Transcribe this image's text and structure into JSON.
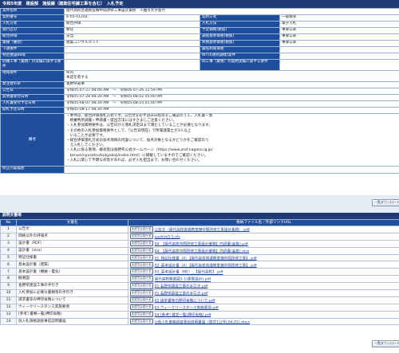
{
  "header": {
    "title": "令和5年度　建設部　施設課（建築住宅課工事を含む）　入札予定"
  },
  "info_rows": [
    {
      "l1": "案件名称",
      "v1": "屋代高校普通教室棟中間改修工事設計業務　千曲市大字屋代",
      "span": true
    },
    {
      "l1": "契約番号",
      "v1": "4-05-01202",
      "l2": "契約方式",
      "v2": "一般競争"
    },
    {
      "l1": "入札方式",
      "v1": "総合評価",
      "l2": "入札方法",
      "v2": "電子入札"
    },
    {
      "l1": "施行区分",
      "v1": "委託",
      "l2": "予定価格(税抜)",
      "v2": "事後公表"
    },
    {
      "l1": "総合評価",
      "v1": "該当",
      "l2": "調査基準価格(税抜)",
      "v2": "事後公表"
    },
    {
      "l1": "業種（種別）",
      "v1": "建築コンサルタント",
      "l2": "失格基準価格(税抜)",
      "v2": "事後公表"
    },
    {
      "l1": "下請要件",
      "v1": "-",
      "l2": "最低制限価格",
      "v2": "-"
    },
    {
      "l1": "特定建設BB等",
      "v1": "-",
      "l2": "WTO(政府調達)案件",
      "v2": "-"
    },
    {
      "l1": "同種工事（業務）の実績に関する要件",
      "v1": "-",
      "l2": "同工事（業務）の契約実績に関する要件",
      "v2": "-"
    },
    {
      "l1": "地域要件",
      "v1": "県内\n本店を有する",
      "span": true
    },
    {
      "l1": "発注者の条",
      "v1": "長野県知事",
      "span": true
    },
    {
      "l1": "公告日",
      "v1": "令和05-07-27 08:00 AM　～　令和06-07-26 11:59 PM",
      "span": true
    },
    {
      "l1": "質問書受付日時",
      "v1": "令和05-07-28 08:30 AM　～　令和05-08-02 05:00 PM",
      "span": true
    },
    {
      "l1": "入札書受付予定日時",
      "v1": "令和05-08-07 08:30 AM　～　令和05-08-10 01:00 PM",
      "span": true
    },
    {
      "l1": "開札予定日時",
      "v1": "令和05-08-17 08:30 AM",
      "span": true
    }
  ],
  "remarks_label": "備考",
  "remarks_lines": [
    "・本件は、総合評価落札方式です。公告文を必ず読み日程等をご確認のうえ、入札書・資",
    "　格審判所調書・申請書・提出方法にはすさまじご注意ください。",
    "・入札参加資格要件は、公告日から落札決定日まで満たしていることが必要となります。",
    "・その他の入札参加資格要件として、「公告日現在」で所属建築士が3人以上",
    "　いることが必要です。",
    "・総合評価落札方式の加点項目の内容について、加点対象となるかどうかをご確認のう",
    "　え入札してください。",
    "・入札に係る重項、様式等は長野県公式ホームページ（https://www.pref.nagano.lg.jp/",
    "　kensei/nyusatsu/kokyokoji/index.html）に掲載していますのでご確認ください。",
    "・入札に関して不明な点等があれば、必ず入札担当まで、お問い合わせください。"
  ],
  "revision_label": "修正内容履歴",
  "revision_value": "",
  "buttons": {
    "back_top": "一覧ダウンロード",
    "back_bottom": "一覧ダウンロード"
  },
  "docs_section": {
    "title": "説明文書等"
  },
  "docs_headers": {
    "no": "No",
    "name": "文書名",
    "link": "格納ファイル名／外部リンクURL"
  },
  "download_label": "ダウンロード",
  "documents": [
    {
      "no": "1",
      "name": "公告文",
      "file": "公告文（屋代高校普通教室棟中間改修工事設計業務）.pdf"
    },
    {
      "no": "2",
      "name": "価格以外の評価点",
      "file": "yashiro5-5.xls"
    },
    {
      "no": "3",
      "name": "設計書（PDF）",
      "file": "04_【屋代高校中間改修工事設計業務】内訳書(金抜).pdf"
    },
    {
      "no": "4",
      "name": "設計書（xlsx）",
      "file": "04_【屋代高校中間改修工事設計業務】内訳書(金抜).xlsx"
    },
    {
      "no": "5",
      "name": "特記仕様書",
      "file": "01_特記仕様書（A）【屋代高校普通教室棟中間改修工事】.pdf"
    },
    {
      "no": "6",
      "name": "基本設計書（建築）",
      "file": "02_基本設計書（A）【屋代高校普通教室棟中間改修工事】.pdf"
    },
    {
      "no": "7",
      "name": "基本設計書（機械・電気）",
      "file": "03_基本設計書（ME）_【屋代高校】.pdf"
    },
    {
      "no": "8",
      "name": "概要図",
      "file": "屋代高校概要図1-1(建築設計).pdf"
    },
    {
      "no": "9",
      "name": "長野県建設工事の手引き",
      "file": "01 長野県建設工事の手引き.pdf"
    },
    {
      "no": "10",
      "name": "入札参加に必要な書類等の手引き",
      "file": "01 長野県建設工事の手引き.pdf"
    },
    {
      "no": "11",
      "name": "請求書等の押印省略について",
      "file": "02 請求書等の押印省略について.pdf"
    },
    {
      "no": "12",
      "name": "ウィークリースタンス実施要領",
      "file": "03 ウィークリースタンス実施要領.pdf"
    },
    {
      "no": "13",
      "name": "[参考] 書類一覧(押印省略)",
      "file": "04 [参考] 様式一覧(押印省略).pdf"
    },
    {
      "no": "14",
      "name": "低入札価格調査事前説明書届",
      "file": "◎低入札価格調査事前説明書届（様式1公号L04.01).docx"
    }
  ]
}
